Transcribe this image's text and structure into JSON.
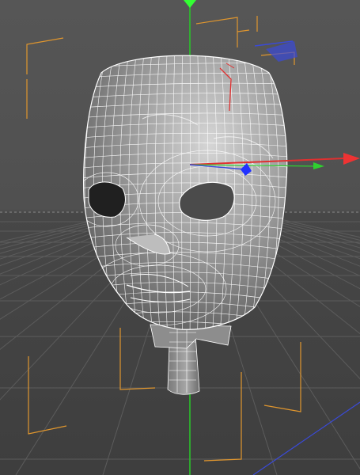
{
  "viewport": {
    "mode": "perspective",
    "colors": {
      "background": "#505050",
      "grid": "#5f5f5f",
      "horizon": "#8a8a8a",
      "bounding_box": "#e0962e",
      "mesh_fill": "#9a9a9a",
      "wireframe": "#ffffff",
      "axis_x": "#e03030",
      "axis_y": "#28d028",
      "axis_z": "#3a4ad8"
    },
    "icons": [
      "move-gizmo-icon",
      "rotation-gizmo-icon",
      "world-axis-icon"
    ]
  }
}
